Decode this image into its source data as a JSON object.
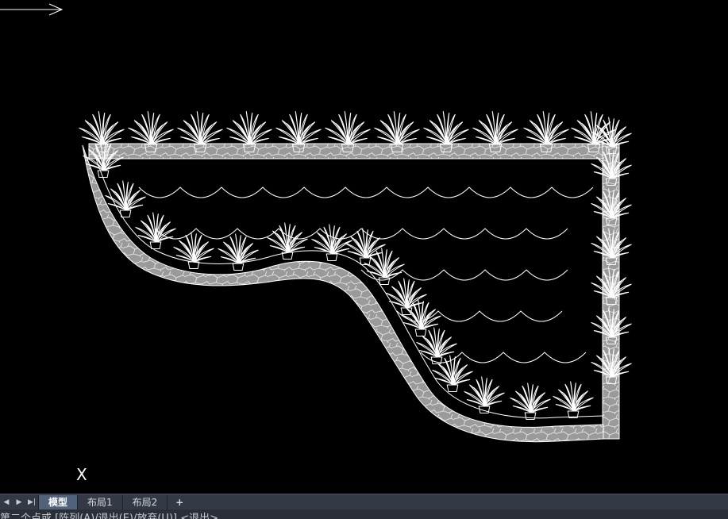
{
  "ucs": {
    "x_label": "X"
  },
  "tabs": {
    "model": "模型",
    "layout1": "布局1",
    "layout2": "布局2",
    "add": "+"
  },
  "nav": {
    "first": "◀",
    "prev": "▶",
    "last": "▶|"
  },
  "command": {
    "text": "第二个点或 [阵列(A)/退出(E)/放弃(U)] <退出>"
  },
  "colors": {
    "background": "#000000",
    "linework": "#ffffff",
    "stone": "#9a9a9a",
    "tab_active": "#51627a"
  }
}
